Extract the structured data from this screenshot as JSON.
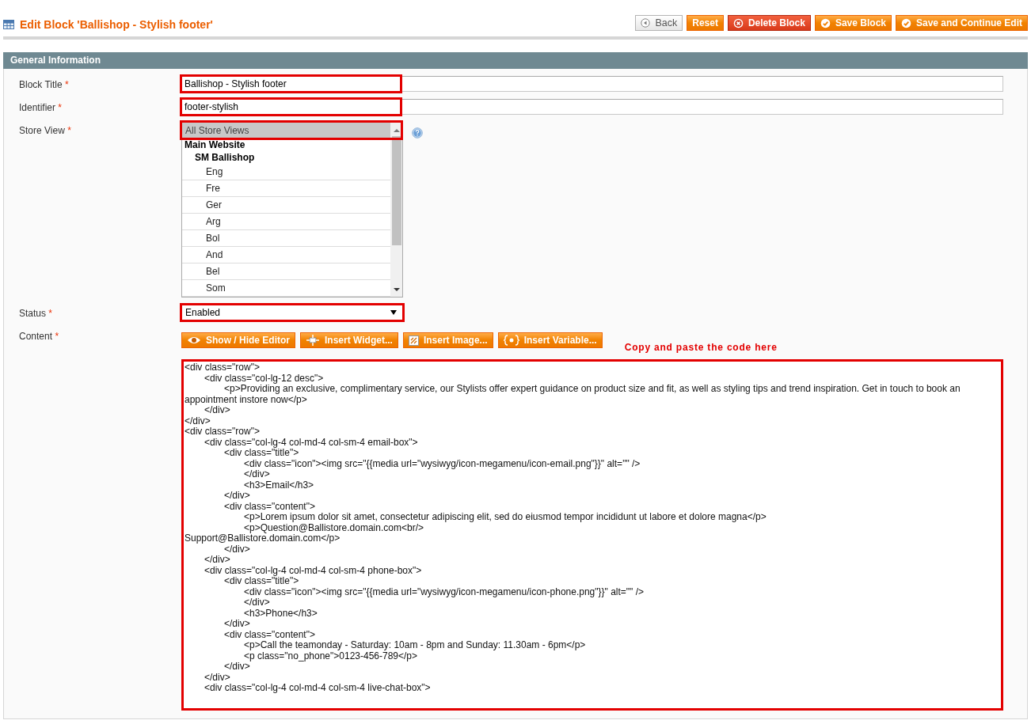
{
  "page_title": "Edit Block 'Ballishop - Stylish footer'",
  "header_buttons": [
    {
      "label": "Back",
      "kind": "back"
    },
    {
      "label": "Reset",
      "kind": "plain"
    },
    {
      "label": "Delete Block",
      "kind": "delete"
    },
    {
      "label": "Save Block",
      "kind": "save"
    },
    {
      "label": "Save and Continue Edit",
      "kind": "save"
    }
  ],
  "section_title": "General Information",
  "fields": [
    {
      "kind": "text",
      "label": "Block Title",
      "required_mark": "*",
      "value": "Ballishop - Stylish footer",
      "highlighted": true
    },
    {
      "kind": "text",
      "label": "Identifier",
      "required_mark": "*",
      "value": "footer-stylish",
      "highlighted": true
    },
    {
      "kind": "multiselect",
      "label": "Store View",
      "required_mark": "*",
      "highlighted": true,
      "options": [
        {
          "label": "All Store Views",
          "kind": "option",
          "selected": true
        },
        {
          "label": "Main Website",
          "kind": "group",
          "children": [
            {
              "label": "SM Ballishop",
              "kind": "group",
              "children": [
                {
                  "label": "Eng",
                  "kind": "option",
                  "selected": false
                },
                {
                  "label": "Fre",
                  "kind": "option",
                  "selected": false
                },
                {
                  "label": "Ger",
                  "kind": "option",
                  "selected": false
                },
                {
                  "label": "Arg",
                  "kind": "option",
                  "selected": false
                },
                {
                  "label": "Bol",
                  "kind": "option",
                  "selected": false
                },
                {
                  "label": "And",
                  "kind": "option",
                  "selected": false
                },
                {
                  "label": "Bel",
                  "kind": "option",
                  "selected": false
                },
                {
                  "label": "Som",
                  "kind": "option",
                  "selected": false
                }
              ]
            }
          ]
        }
      ]
    },
    {
      "kind": "select",
      "label": "Status",
      "required_mark": "*",
      "value": "Enabled",
      "highlighted": true
    },
    {
      "kind": "editor",
      "label": "Content",
      "required_mark": "*",
      "highlighted": true,
      "note": "Copy and paste the code here",
      "buttons": [
        {
          "label": "Show / Hide Editor",
          "kind": "eye"
        },
        {
          "label": "Insert Widget...",
          "kind": "widget"
        },
        {
          "label": "Insert Image...",
          "kind": "image"
        },
        {
          "label": "Insert Variable...",
          "kind": "variable"
        }
      ],
      "value": "<div class=\"row\">\n\t<div class=\"col-lg-12 desc\">\n\t\t<p>Providing an exclusive, complimentary service, our Stylists offer expert guidance on product size and fit, as well as styling tips and trend inspiration. Get in touch to book an appointment instore now</p>\n\t</div>\n</div>\n<div class=\"row\">\n\t<div class=\"col-lg-4 col-md-4 col-sm-4 email-box\">\n\t\t<div class=\"title\">\n\t\t\t<div class=\"icon\"><img src=\"{{media url=\"wysiwyg/icon-megamenu/icon-email.png\"}}\" alt=\"\" />\n\t\t\t</div>\n\t\t\t<h3>Email</h3>\n\t\t</div>\n\t\t<div class=\"content\">\n\t\t\t<p>Lorem ipsum dolor sit amet, consectetur adipiscing elit, sed do eiusmod tempor incididunt ut labore et dolore magna</p>\n\t\t\t<p>Question@Ballistore.domain.com<br/>\nSupport@Ballistore.domain.com</p>\n\t\t</div>\n\t</div>\n\t<div class=\"col-lg-4 col-md-4 col-sm-4 phone-box\">\n\t\t<div class=\"title\">\n\t\t\t<div class=\"icon\"><img src=\"{{media url=\"wysiwyg/icon-megamenu/icon-phone.png\"}}\" alt=\"\" />\n\t\t\t</div>\n\t\t\t<h3>Phone</h3>\n\t\t</div>\n\t\t<div class=\"content\">\n\t\t\t<p>Call the teamonday - Saturday: 10am - 8pm and Sunday: 11.30am - 6pm</p>\n\t\t\t<p class=\"no_phone\">0123-456-789</p>\n\t\t</div>\n\t</div>\n\t<div class=\"col-lg-4 col-md-4 col-sm-4 live-chat-box\">"
    }
  ]
}
